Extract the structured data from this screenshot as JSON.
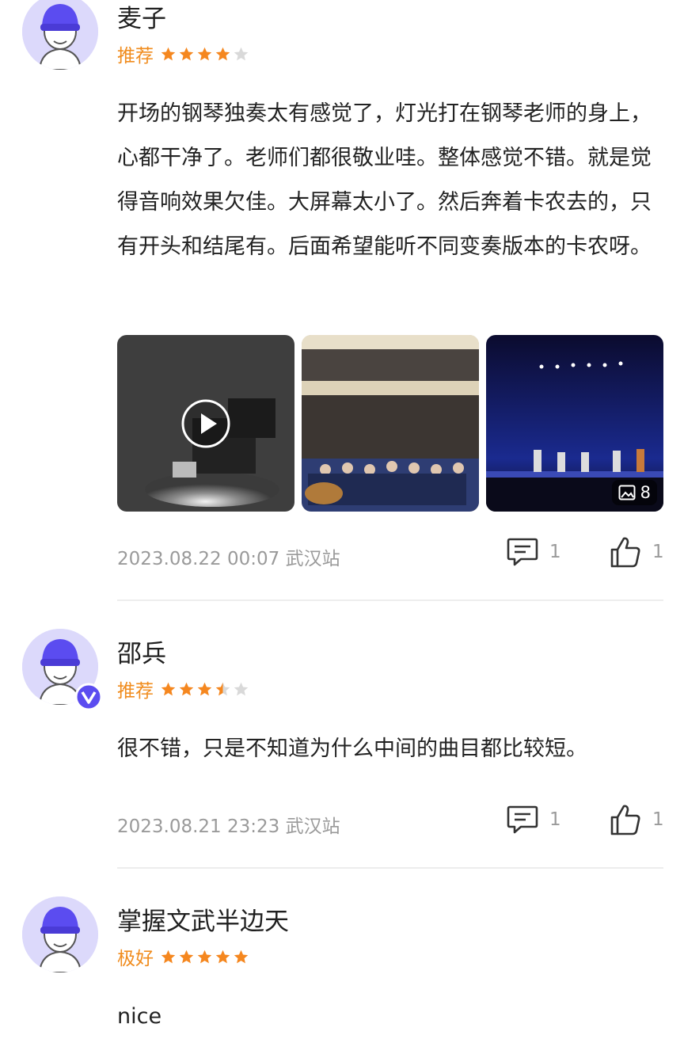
{
  "reviews": [
    {
      "user": "麦子",
      "rating_label": "推荐",
      "stars": 4,
      "text": "开场的钢琴独奏太有感觉了，灯光打在钢琴老师的身上，心都干净了。老师们都很敬业哇。整体感觉不错。就是觉得音响效果欠佳。大屏幕太小了。然后奔着卡农去的，只有开头和结尾有。后面希望能听不同变奏版本的卡农呀。",
      "photo_count": "8",
      "time": "2023.08.22 00:07",
      "station": "武汉站",
      "comments": "1",
      "likes": "1"
    },
    {
      "user": "邵兵",
      "rating_label": "推荐",
      "stars": 3.5,
      "text": "很不错，只是不知道为什么中间的曲目都比较短。",
      "time": "2023.08.21 23:23",
      "station": "武汉站",
      "comments": "1",
      "likes": "1"
    },
    {
      "user": "掌握文武半边天",
      "rating_label": "极好",
      "stars": 5,
      "text": "nice"
    }
  ],
  "colors": {
    "star_active": "#f5871f",
    "star_inactive": "#d9d9d9",
    "rating_text": "#f08c1e",
    "meta_text": "#9a9a9a",
    "avatar_bg": "#dcd9fb",
    "hat": "#5b4cf0",
    "badge": "#5b4cf0"
  },
  "icons": {
    "comment": "comment-icon",
    "like": "thumbs-up-icon",
    "gallery": "image-gallery-icon",
    "play": "play-icon",
    "verified": "verified-v-badge-icon"
  }
}
